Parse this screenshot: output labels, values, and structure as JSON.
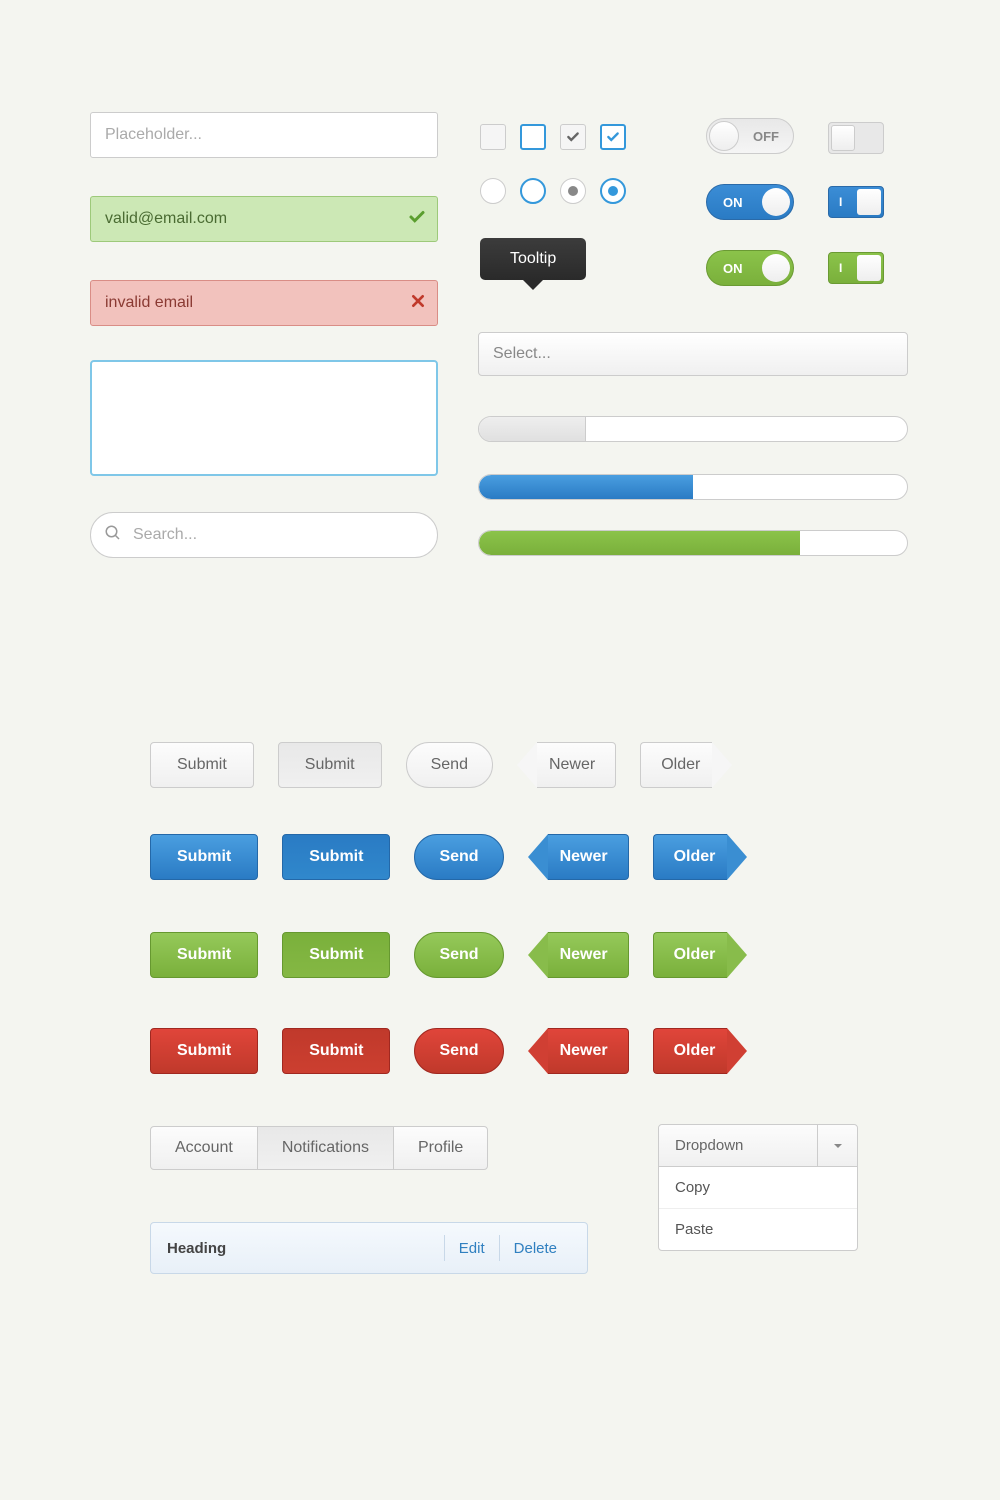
{
  "inputs": {
    "placeholder": "Placeholder...",
    "valid_value": "valid@email.com",
    "invalid_value": "invalid email",
    "search_placeholder": "Search..."
  },
  "tooltip": "Tooltip",
  "toggles": {
    "off": "OFF",
    "on": "ON",
    "i": "I"
  },
  "select": {
    "placeholder": "Select..."
  },
  "buttons": {
    "submit": "Submit",
    "send": "Send",
    "newer": "Newer",
    "older": "Older"
  },
  "tabs": [
    "Account",
    "Notifications",
    "Profile"
  ],
  "heading": {
    "title": "Heading",
    "edit": "Edit",
    "delete": "Delete"
  },
  "dropdown": {
    "label": "Dropdown",
    "items": [
      "Copy",
      "Paste"
    ]
  },
  "progress": {
    "gray": 25,
    "blue": 50,
    "green": 75
  }
}
